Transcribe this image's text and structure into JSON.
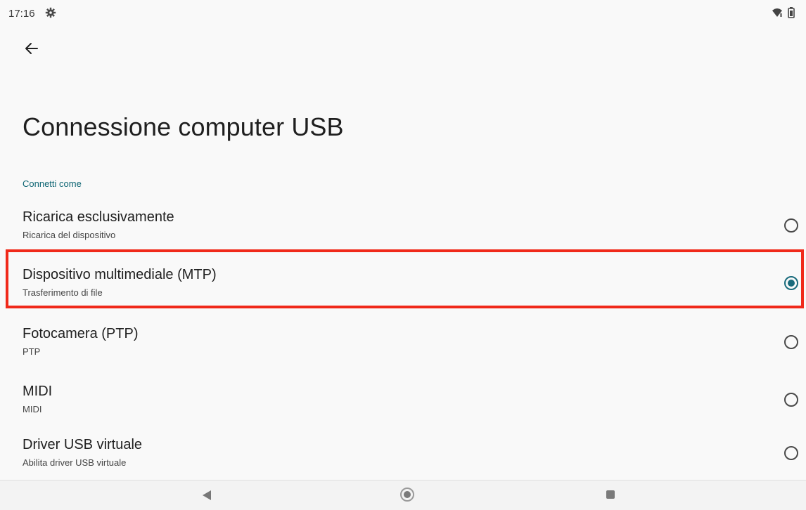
{
  "status_bar": {
    "time": "17:16",
    "icons": [
      "gear-icon",
      "wifi-icon",
      "battery-icon"
    ]
  },
  "header": {
    "back_icon": "back-arrow-icon"
  },
  "page": {
    "title": "Connessione computer USB",
    "section_header": "Connetti come"
  },
  "options": [
    {
      "title": "Ricarica esclusivamente",
      "subtitle": "Ricarica del dispositivo",
      "selected": false
    },
    {
      "title": "Dispositivo multimediale (MTP)",
      "subtitle": "Trasferimento di file",
      "selected": true
    },
    {
      "title": "Fotocamera (PTP)",
      "subtitle": "PTP",
      "selected": false
    },
    {
      "title": "MIDI",
      "subtitle": "MIDI",
      "selected": false
    },
    {
      "title": "Driver USB virtuale",
      "subtitle": "Abilita driver USB virtuale",
      "selected": false
    }
  ],
  "nav_bar": {
    "icons": [
      "nav-back-icon",
      "nav-home-icon",
      "nav-recents-icon"
    ]
  },
  "colors": {
    "accent": "#1a6b7c",
    "section_header": "#0f6674",
    "highlight": "#f0291a",
    "background": "#f9f9f9"
  }
}
